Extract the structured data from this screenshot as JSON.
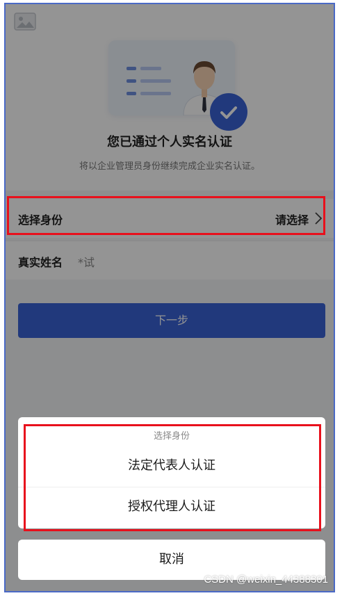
{
  "hero": {
    "title": "您已通过个人实名认证",
    "subtitle": "将以企业管理员身份继续完成企业实名认证。"
  },
  "form": {
    "identity_label": "选择身份",
    "identity_value": "请选择",
    "name_label": "真实姓名",
    "name_value": "*试"
  },
  "next_button": "下一步",
  "sheet": {
    "title": "选择身份",
    "options": [
      "法定代表人认证",
      "授权代理人认证"
    ],
    "cancel": "取消"
  },
  "watermark": "CSDN @weixin_44388301",
  "icons": [
    "image-placeholder-icon",
    "id-card-illustration",
    "check-badge-icon",
    "chevron-right-icon"
  ],
  "colors": {
    "primary": "#3a63d6",
    "highlight": "#e8101c",
    "frame": "#4a69c6"
  }
}
